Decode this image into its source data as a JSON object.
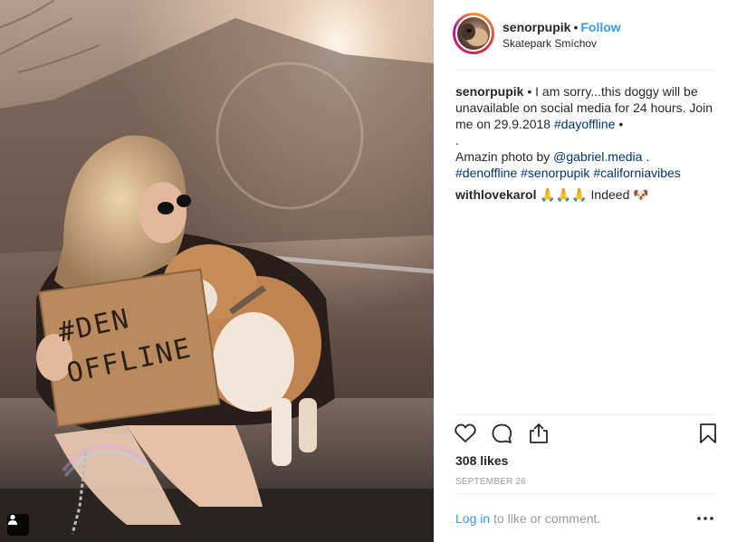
{
  "post": {
    "username": "senorpupik",
    "follow_label": "Follow",
    "location": "Skatepark Smíchov",
    "caption": {
      "username": "senorpupik",
      "line1": " • I am sorry...this doggy will be",
      "line2": "unavailable on social media for 24 hours. Join",
      "line3_prefix": "me on 29.9.2018 ",
      "hashtag_dayoffline": "#dayoffline",
      "line3_suffix": " •",
      "line4": ".",
      "line5_prefix": "Amazin photo by ",
      "mention": "@gabriel.media",
      "line5_suffix": " .",
      "tags": [
        "#denoffline",
        "#senorpupik",
        "#californiavibes"
      ]
    },
    "comments": [
      {
        "username": "withlovekarol",
        "text": " 🙏🙏🙏 Indeed 🐶"
      }
    ],
    "likes": "308 likes",
    "date": "SEPTEMBER 26",
    "login_link": "Log in",
    "login_text": " to like or comment.",
    "sign_text": "#DEN OFFLINE"
  },
  "icons": [
    "heart-icon",
    "comment-icon",
    "share-icon",
    "bookmark-icon",
    "more-icon",
    "user-tag-icon"
  ]
}
